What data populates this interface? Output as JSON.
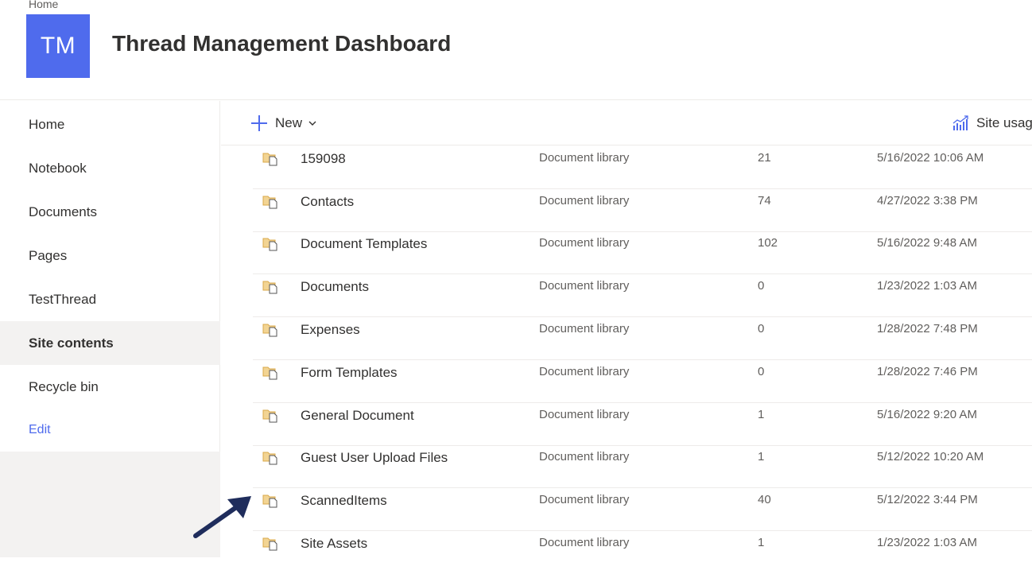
{
  "header": {
    "breadcrumb": "Home",
    "logo_initials": "TM",
    "site_title": "Thread Management Dashboard"
  },
  "nav": {
    "items": [
      {
        "label": "Home"
      },
      {
        "label": "Notebook"
      },
      {
        "label": "Documents"
      },
      {
        "label": "Pages"
      },
      {
        "label": "TestThread"
      },
      {
        "label": "Site contents",
        "selected": true
      },
      {
        "label": "Recycle bin"
      }
    ],
    "edit_label": "Edit"
  },
  "commandbar": {
    "new_label": "New",
    "site_usage_label": "Site usag"
  },
  "contents": {
    "rows": [
      {
        "name": "159098",
        "type": "Document library",
        "items": "21",
        "modified": "5/16/2022 10:06 AM"
      },
      {
        "name": "Contacts",
        "type": "Document library",
        "items": "74",
        "modified": "4/27/2022 3:38 PM"
      },
      {
        "name": "Document Templates",
        "type": "Document library",
        "items": "102",
        "modified": "5/16/2022 9:48 AM"
      },
      {
        "name": "Documents",
        "type": "Document library",
        "items": "0",
        "modified": "1/23/2022 1:03 AM"
      },
      {
        "name": "Expenses",
        "type": "Document library",
        "items": "0",
        "modified": "1/28/2022 7:48 PM"
      },
      {
        "name": "Form Templates",
        "type": "Document library",
        "items": "0",
        "modified": "1/28/2022 7:46 PM"
      },
      {
        "name": "General Document",
        "type": "Document library",
        "items": "1",
        "modified": "5/16/2022 9:20 AM"
      },
      {
        "name": "Guest User Upload Files",
        "type": "Document library",
        "items": "1",
        "modified": "5/12/2022 10:20 AM"
      },
      {
        "name": "ScannedItems",
        "type": "Document library",
        "items": "40",
        "modified": "5/12/2022 3:44 PM"
      },
      {
        "name": "Site Assets",
        "type": "Document library",
        "items": "1",
        "modified": "1/23/2022 1:03 AM"
      }
    ]
  },
  "colors": {
    "accent": "#4f6bed",
    "annotation_arrow": "#1f2d5c"
  }
}
